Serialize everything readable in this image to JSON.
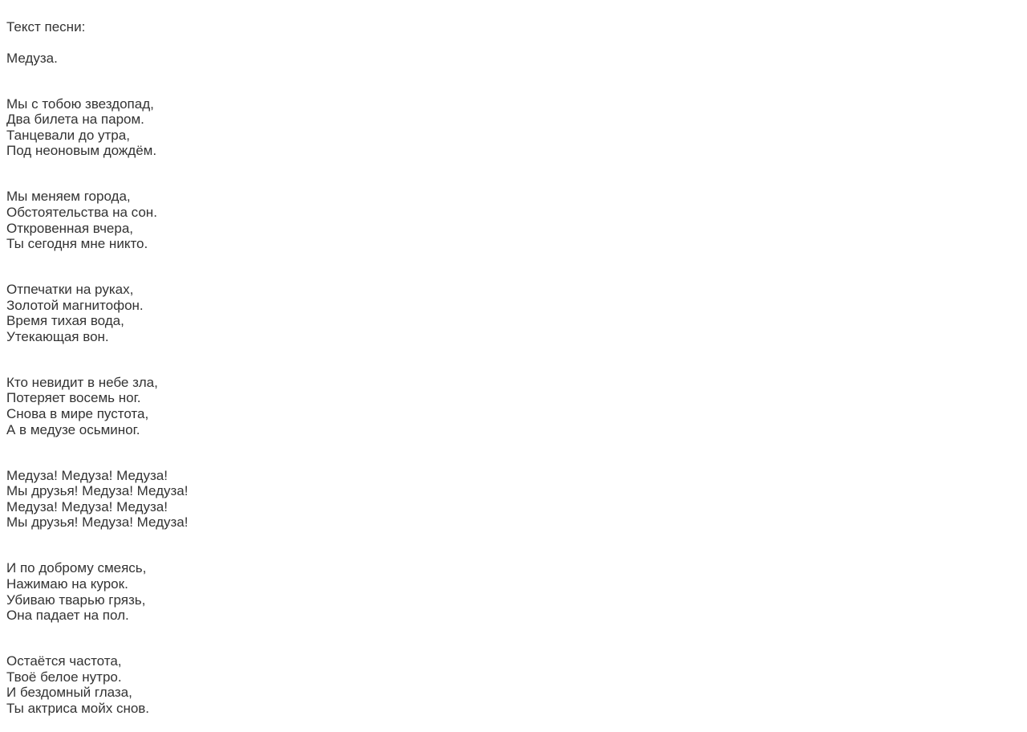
{
  "header": "Текст песни:",
  "title": "Медуза.",
  "stanzas": [
    "Мы с тобою звездопад,\nДва билета на паром.\nТанцевали до утра,\nПод неоновым дождём.",
    "Мы меняем города,\nОбстоятельства на сон.\nОткровенная вчера,\nТы сегодня мне никто.",
    "Отпечатки на руках,\nЗолотой магнитофон.\nВремя тихая вода,\nУтекающая вон.",
    "Кто невидит в небе зла,\nПотеряет восемь ног.\nСнова в мире пустота,\nА в медузе осьминог.",
    "Медуза! Медуза! Медуза!\nМы друзья! Медуза! Медуза!\nМедуза! Медуза! Медуза!\nМы друзья! Медуза! Медуза!",
    "И по доброму смеясь,\nНажимаю на курок.\nУбиваю тварью грязь,\nОна падает на пол.",
    "Остаётся частота,\nТвоё белое нутро.\nИ бездомный глаза,\nТы актриса мойх снов."
  ]
}
